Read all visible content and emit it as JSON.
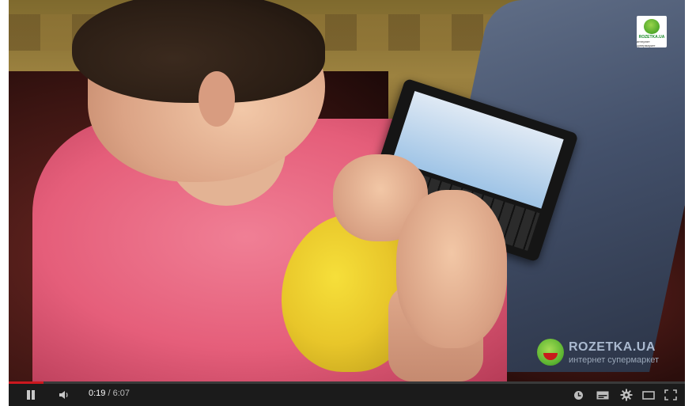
{
  "player": {
    "time_current": "0:19",
    "time_separator": " / ",
    "time_total": "6:07",
    "progress_fraction": 0.052,
    "accent_color": "#cc181e"
  },
  "watermark": {
    "corner_logo_name": "ROZETKA.UA",
    "corner_logo_tag": "интернет супермаркет",
    "brand_name": "ROZETKA.UA",
    "brand_tag": "интернет супермаркет"
  },
  "icons": {
    "play_pause": "pause-icon",
    "volume": "volume-icon",
    "watch_later": "clock-icon",
    "captions": "captions-icon",
    "settings": "gear-icon",
    "theater": "theater-icon",
    "fullscreen": "fullscreen-icon"
  }
}
